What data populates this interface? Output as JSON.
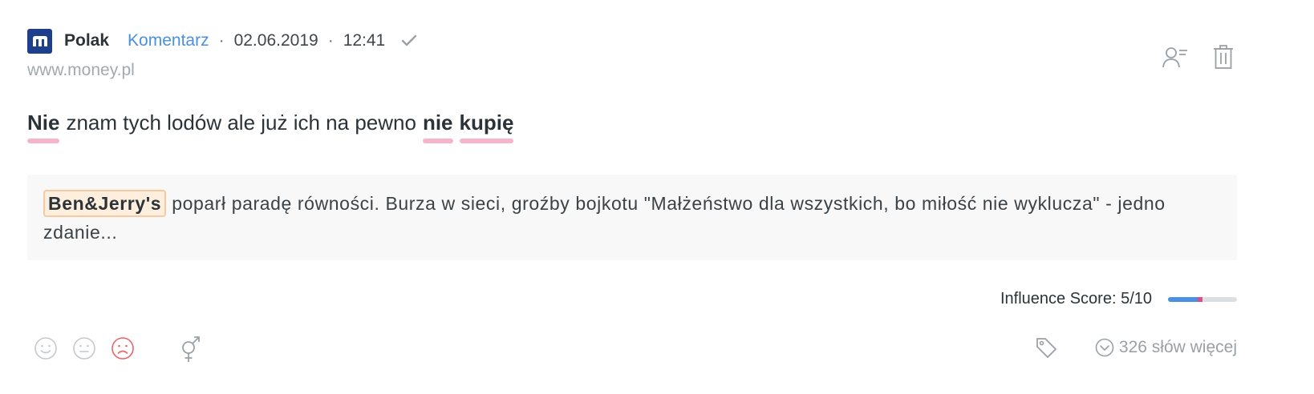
{
  "post": {
    "author": "Polak",
    "type": "Komentarz",
    "separator": "·",
    "date": "02.06.2019",
    "time": "12:41",
    "source": "www.money.pl",
    "logo_icon": "money-pl-logo-icon",
    "verified_icon": "check-icon"
  },
  "actions": {
    "assign_icon": "user-assign-icon",
    "delete_icon": "trash-icon"
  },
  "content": {
    "segments": [
      {
        "text": "Nie",
        "keyword": true
      },
      {
        "text": "znam tych lodów ale już ich na pewno",
        "keyword": false
      },
      {
        "text": "nie",
        "keyword": true
      },
      {
        "text": "kupię",
        "keyword": true
      }
    ]
  },
  "article": {
    "brand": "Ben&Jerry's",
    "text": " poparł paradę równości. Burza w sieci, groźby bojkotu \"Małżeństwo dla wszystkich, bo miłość nie wyklucza\" - jedno zdanie..."
  },
  "influence": {
    "label": "Influence Score: 5/10",
    "score": 5,
    "max": 10,
    "fill_color": "#4a90e2",
    "marker_color": "#e04b8a"
  },
  "footer": {
    "sentiments": [
      "positive-sentiment-icon",
      "neutral-sentiment-icon",
      "negative-sentiment-icon"
    ],
    "active_sentiment": "negative",
    "gender_icon": "gender-icon",
    "tag_icon": "tag-icon",
    "more_label": "326 słów więcej",
    "more_icon": "chevron-down-circle-icon"
  },
  "colors": {
    "accent": "#4a90e2",
    "keyword_underline": "#f8b4c8",
    "brand_tag_bg": "#fdeede",
    "negative": "#e8666a",
    "logo_bg": "#1d3f8c"
  }
}
